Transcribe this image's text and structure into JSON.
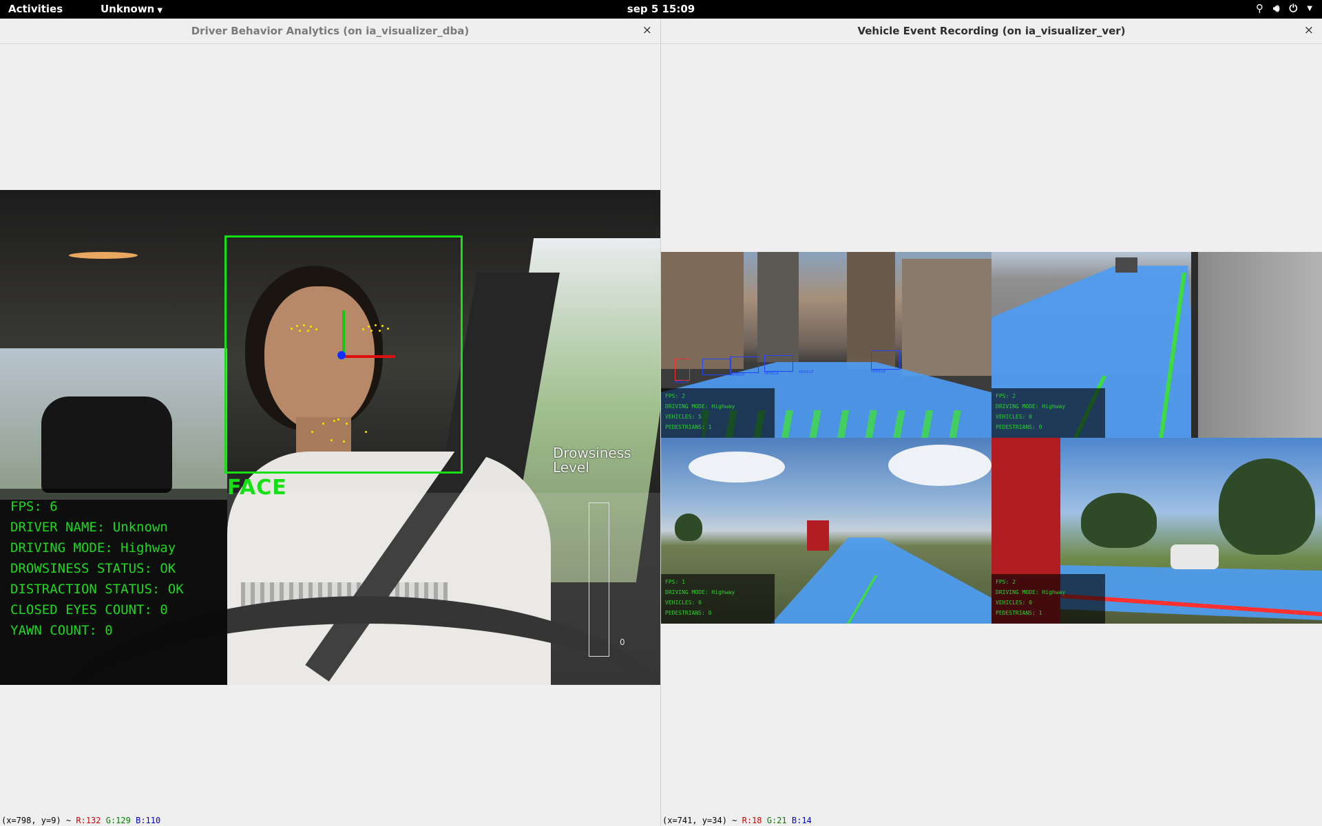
{
  "topbar": {
    "activities": "Activities",
    "app_menu": "Unknown",
    "clock": "sep 5  15:09",
    "icons": [
      "network-icon",
      "volume-icon",
      "power-icon",
      "chevron-down-icon"
    ]
  },
  "left_window": {
    "title": "Driver Behavior Analytics (on ia_visualizer_dba)",
    "close": "×",
    "video": {
      "face_label": "FACE",
      "info_lines": [
        "FPS: 6",
        "DRIVER NAME: Unknown",
        "DRIVING MODE: Highway",
        "DROWSINESS STATUS: OK",
        "DISTRACTION STATUS: OK",
        "CLOSED EYES COUNT: 0",
        "YAWN COUNT: 0"
      ],
      "drowsiness_label_1": "Drowsiness",
      "drowsiness_label_2": "Level",
      "drowsiness_value": "0",
      "colors": {
        "overlay_text": "#1ed81e",
        "face_box": "#14e014",
        "axis_red": "#e01010",
        "axis_blue": "#1030ff"
      }
    },
    "status": {
      "coords": "(x=798, y=9) ~ ",
      "r": "R:132",
      "g": "G:129",
      "b": "B:110"
    }
  },
  "right_window": {
    "title": "Vehicle Event Recording (on ia_visualizer_ver)",
    "close": "×",
    "tiles": [
      {
        "lines": [
          "FPS: 2",
          "DRIVING MODE: Highway",
          "VEHICLES: 5",
          "PEDESTRIANS: 1"
        ],
        "box_labels": [
          "PERSON",
          "VEHICLE",
          "VEHICLE",
          "VEHICLE",
          "VEHICLE"
        ]
      },
      {
        "lines": [
          "FPS: 2",
          "DRIVING MODE: Highway",
          "VEHICLES: 0",
          "PEDESTRIANS: 0"
        ]
      },
      {
        "lines": [
          "FPS: 1",
          "DRIVING MODE: Highway",
          "VEHICLES: 0",
          "PEDESTRIANS: 0"
        ]
      },
      {
        "lines": [
          "FPS: 2",
          "DRIVING MODE: Highway",
          "VEHICLES: 0",
          "PEDESTRIANS: 1"
        ]
      }
    ],
    "status": {
      "coords": "(x=741, y=34) ~ ",
      "r": "R:18",
      "g": "G:21",
      "b": "B:14"
    }
  }
}
